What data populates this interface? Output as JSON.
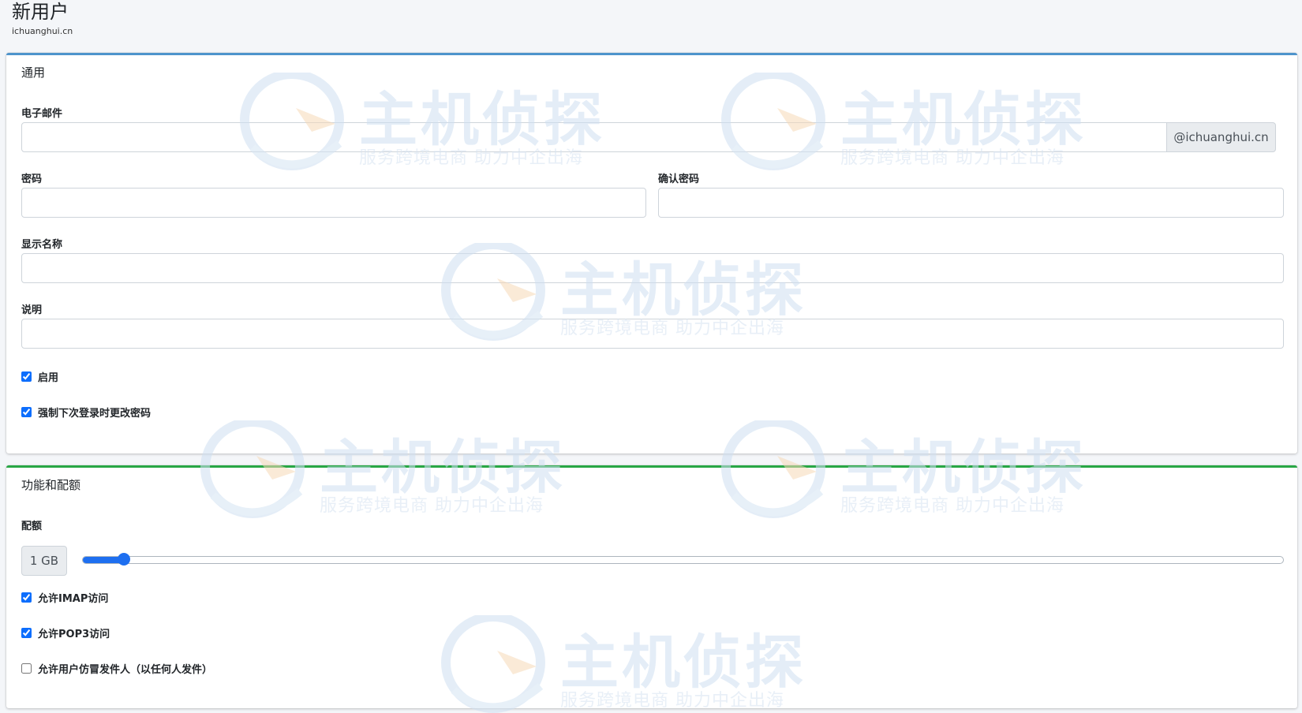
{
  "header": {
    "title": "新用户",
    "subtitle": "ichuanghui.cn"
  },
  "general": {
    "title": "通用",
    "email": {
      "label": "电子邮件",
      "value": "",
      "placeholder": "",
      "domain_suffix": "@ichuanghui.cn"
    },
    "password": {
      "label": "密码",
      "value": ""
    },
    "confirm_password": {
      "label": "确认密码",
      "value": ""
    },
    "display_name": {
      "label": "显示名称",
      "value": ""
    },
    "description": {
      "label": "说明",
      "value": ""
    },
    "enabled": {
      "label": "启用",
      "checked": true
    },
    "force_change_password": {
      "label": "强制下次登录时更改密码",
      "checked": true
    }
  },
  "features": {
    "title": "功能和配额",
    "quota": {
      "label": "配额",
      "value_text": "1 GB",
      "slider_fraction": 0.034
    },
    "imap": {
      "label": "允许IMAP访问",
      "checked": true
    },
    "pop3": {
      "label": "允许POP3访问",
      "checked": true
    },
    "spoof": {
      "label": "允许用户仿冒发件人（以任何人发件）",
      "checked": false
    }
  },
  "watermark": {
    "brand": "主机侦探",
    "slogan": "服务跨境电商 助力中企出海"
  },
  "colors": {
    "general_accent": "#4e94cc",
    "features_accent": "#28a745",
    "control_blue": "#1e6ff0"
  }
}
